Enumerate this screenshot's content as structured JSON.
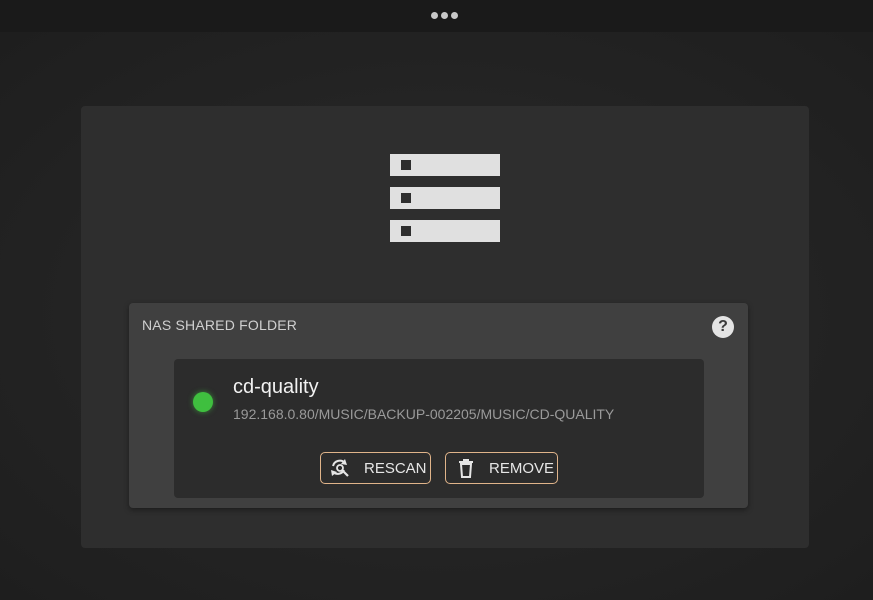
{
  "topbar": {
    "menu_icon": "ellipsis-icon"
  },
  "card": {
    "icon": "server-rack-icon"
  },
  "nas_panel": {
    "title": "NAS SHARED FOLDER",
    "help_icon": "question-mark-icon",
    "help_glyph": "?"
  },
  "share": {
    "status_icon": "status-online-icon",
    "status_color": "#3fbf3f",
    "name": "cd-quality",
    "path": "192.168.0.80/MUSIC/BACKUP-002205/MUSIC/CD-QUALITY",
    "rescan_label": "RESCAN",
    "rescan_icon": "rescan-icon",
    "remove_label": "REMOVE",
    "remove_icon": "trash-icon",
    "button_border_color": "#e0b48a"
  }
}
